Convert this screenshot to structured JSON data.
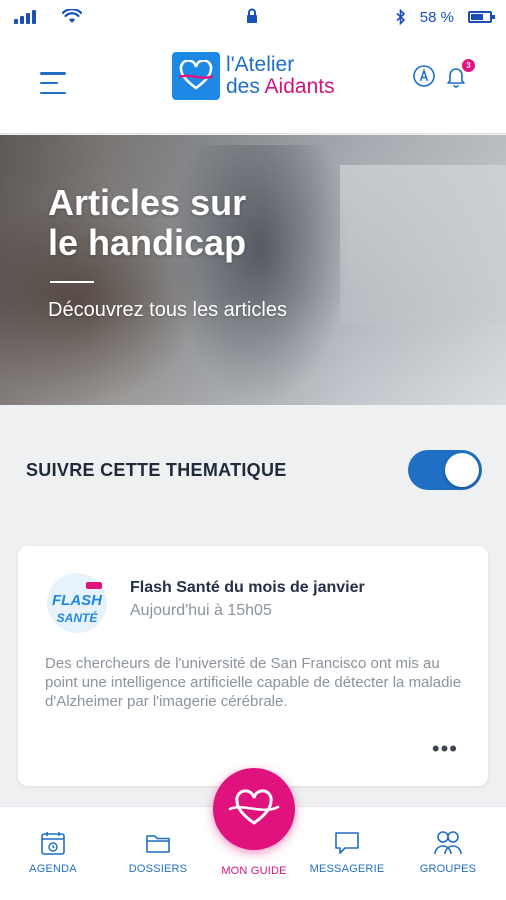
{
  "status_bar": {
    "battery_text": "58 %",
    "icons": [
      "signal-icon",
      "wifi-icon",
      "lock-icon",
      "bluetooth-icon",
      "battery-icon"
    ]
  },
  "header": {
    "logo_line1": "l'Atelier",
    "logo_line2_part1": "des ",
    "logo_line2_part2": "Aidants",
    "notification_count": "3",
    "icons": [
      "menu-icon",
      "profile-icon",
      "bell-icon"
    ]
  },
  "hero": {
    "title_line1": "Articles sur",
    "title_line2": "le handicap",
    "subtitle": "Découvrez tous les articles"
  },
  "follow": {
    "label": "SUIVRE CETTE THEMATIQUE",
    "enabled": true
  },
  "article": {
    "thumb_line1": "FLASH",
    "thumb_line2": "SANTÉ",
    "title": "Flash Santé du mois de janvier",
    "time": "Aujourd'hui à 15h05",
    "body": "Des chercheurs de l'université de San Francisco ont mis au point une intelligence artificielle capable de détecter la maladie d'Alzheimer par l'imagerie cérébrale.",
    "more_label": "•••"
  },
  "bottom_nav": {
    "items": [
      {
        "label": "AGENDA",
        "icon": "calendar-icon"
      },
      {
        "label": "DOSSIERS",
        "icon": "folder-icon"
      },
      {
        "label": "MON GUIDE",
        "icon": "heart-knot-icon",
        "active": true
      },
      {
        "label": "MESSAGERIE",
        "icon": "chat-icon"
      },
      {
        "label": "GROUPES",
        "icon": "group-icon"
      }
    ]
  },
  "colors": {
    "brand_blue": "#1f6fc4",
    "brand_pink": "#e0127d",
    "background": "#eef0f2"
  }
}
